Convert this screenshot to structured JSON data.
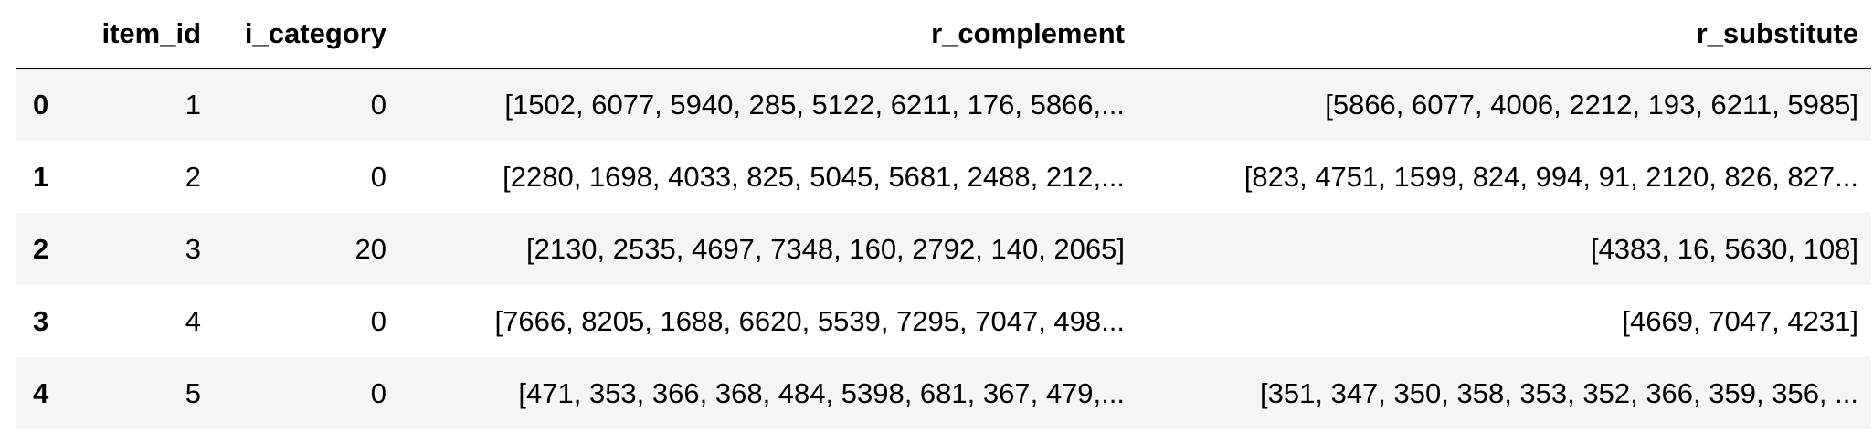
{
  "table": {
    "index_header": "",
    "columns": [
      "item_id",
      "i_category",
      "r_complement",
      "r_substitute"
    ],
    "rows": [
      {
        "index": "0",
        "item_id": "1",
        "i_category": "0",
        "r_complement": "[1502, 6077, 5940, 285, 5122, 6211, 176, 5866,...",
        "r_substitute": "[5866, 6077, 4006, 2212, 193, 6211, 5985]"
      },
      {
        "index": "1",
        "item_id": "2",
        "i_category": "0",
        "r_complement": "[2280, 1698, 4033, 825, 5045, 5681, 2488, 212,...",
        "r_substitute": "[823, 4751, 1599, 824, 994, 91, 2120, 826, 827..."
      },
      {
        "index": "2",
        "item_id": "3",
        "i_category": "20",
        "r_complement": "[2130, 2535, 4697, 7348, 160, 2792, 140, 2065]",
        "r_substitute": "[4383, 16, 5630, 108]"
      },
      {
        "index": "3",
        "item_id": "4",
        "i_category": "0",
        "r_complement": "[7666, 8205, 1688, 6620, 5539, 7295, 7047, 498...",
        "r_substitute": "[4669, 7047, 4231]"
      },
      {
        "index": "4",
        "item_id": "5",
        "i_category": "0",
        "r_complement": "[471, 353, 366, 368, 484, 5398, 681, 367, 479,...",
        "r_substitute": "[351, 347, 350, 358, 353, 352, 366, 359, 356, ..."
      }
    ]
  },
  "colors": {
    "stripe": "#f5f5f5",
    "background": "#ffffff",
    "text": "#000000"
  }
}
